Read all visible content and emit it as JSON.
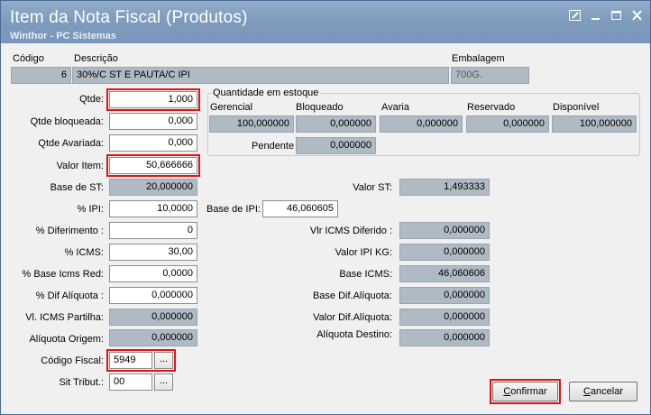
{
  "window": {
    "title": "Item da Nota Fiscal (Produtos)",
    "subtitle": "Winthor - PC Sistemas",
    "controls": [
      "edit-icon",
      "minimize-icon",
      "maximize-icon",
      "close-icon"
    ]
  },
  "header": {
    "codigo_label": "Código",
    "codigo_value": "6",
    "descricao_label": "Descrição",
    "descricao_value": "30%/C ST E PAUTA/C IPI",
    "embalagem_label": "Embalagem",
    "embalagem_value": "700G."
  },
  "left": {
    "qtde_label": "Qtde:",
    "qtde_value": "1,000",
    "qtde_bloqueada_label": "Qtde bloqueada:",
    "qtde_bloqueada_value": "0,000",
    "qtde_avariada_label": "Qtde Avariada:",
    "qtde_avariada_value": "0,000",
    "valor_item_label": "Valor Item:",
    "valor_item_value": "50,666666",
    "base_st_label": "Base de ST:",
    "base_st_value": "20,000000",
    "ipi_label": "% IPI:",
    "ipi_value": "10,0000",
    "diferimento_label": "%  Diferimento :",
    "diferimento_value": "0",
    "icms_label": "% ICMS:",
    "icms_value": "30,00",
    "base_icms_red_label": "% Base Icms Red:",
    "base_icms_red_value": "0,0000",
    "dif_aliquota_label": "% Dif Alíquota :",
    "dif_aliquota_value": "0,000000",
    "icms_partilha_label": "Vl. ICMS Partilha:",
    "icms_partilha_value": "0,000000",
    "aliquota_origem_label": "Alíquota Origem:",
    "aliquota_origem_value": "0,000000",
    "codigo_fiscal_label": "Código Fiscal:",
    "codigo_fiscal_value": "5949",
    "sit_tribut_label": "Sit Tribut.:",
    "sit_tribut_value": "00",
    "lookup_label": "..."
  },
  "estoque": {
    "group_title": "Quantidade em estoque",
    "gerencial_label": "Gerencial",
    "gerencial_value": "100,000000",
    "bloqueado_label": "Bloqueado",
    "bloqueado_value": "0,000000",
    "avaria_label": "Avaria",
    "avaria_value": "0,000000",
    "reservado_label": "Reservado",
    "reservado_value": "0,000000",
    "disponivel_label": "Disponível",
    "disponivel_value": "100,000000",
    "pendente_label": "Pendente",
    "pendente_value": "0,000000"
  },
  "middle": {
    "base_ipi_label": "Base de IPI:",
    "base_ipi_value": "46,060605"
  },
  "right": {
    "valor_st_label": "Valor ST:",
    "valor_st_value": "1,493333",
    "icms_diferido_label": "Vlr ICMS Diferido :",
    "icms_diferido_value": "0,000000",
    "ipi_kg_label": "Valor IPI KG:",
    "ipi_kg_value": "0,000000",
    "base_icms_label": "Base ICMS:",
    "base_icms_value": "46,060606",
    "base_dif_aliquota_label": "Base Dif.Alíquota:",
    "base_dif_aliquota_value": "0,000000",
    "valor_dif_aliquota_label": "Valor Dif.Alíquota:",
    "valor_dif_aliquota_value": "0,000000",
    "aliquota_destino_label": "Alíquota Destino:",
    "aliquota_destino_value": "0,000000"
  },
  "buttons": {
    "confirmar_first": "C",
    "confirmar_rest": "onfirmar",
    "cancelar_first": "C",
    "cancelar_rest": "ancelar"
  },
  "colors": {
    "titlebar": "#7f9cbd",
    "readonly_field": "#b0bac4",
    "highlight": "#e01414"
  }
}
